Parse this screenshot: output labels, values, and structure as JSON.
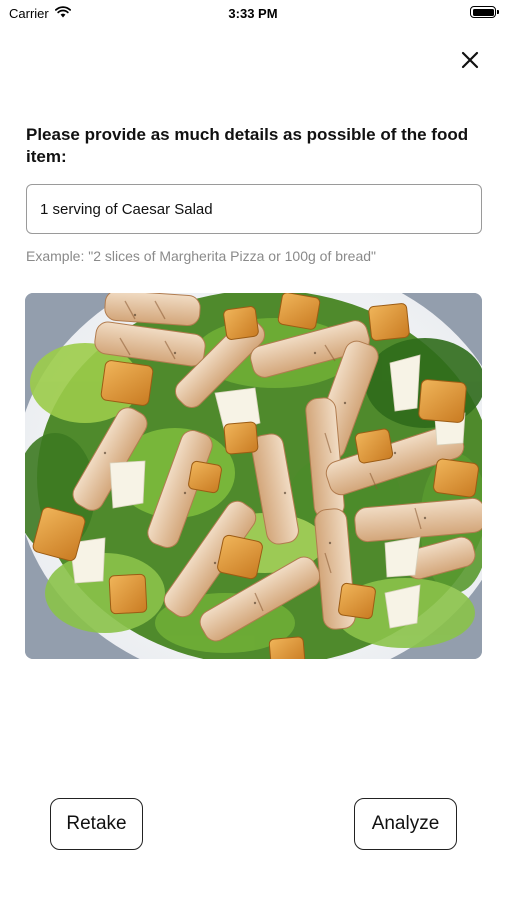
{
  "status_bar": {
    "carrier": "Carrier",
    "time": "3:33 PM"
  },
  "close": {
    "icon": "close-icon"
  },
  "form": {
    "prompt": "Please provide as much details as possible of the food item:",
    "input_value": "1 serving of Caesar Salad",
    "example": "Example: \"2 slices of Margherita Pizza or 100g of bread\""
  },
  "photo": {
    "subject": "caesar-salad-photo"
  },
  "buttons": {
    "retake": "Retake",
    "analyze": "Analyze"
  },
  "colors": {
    "background": "#ffffff",
    "hint_text": "#8a8a8a",
    "border": "#9a9a9a"
  }
}
